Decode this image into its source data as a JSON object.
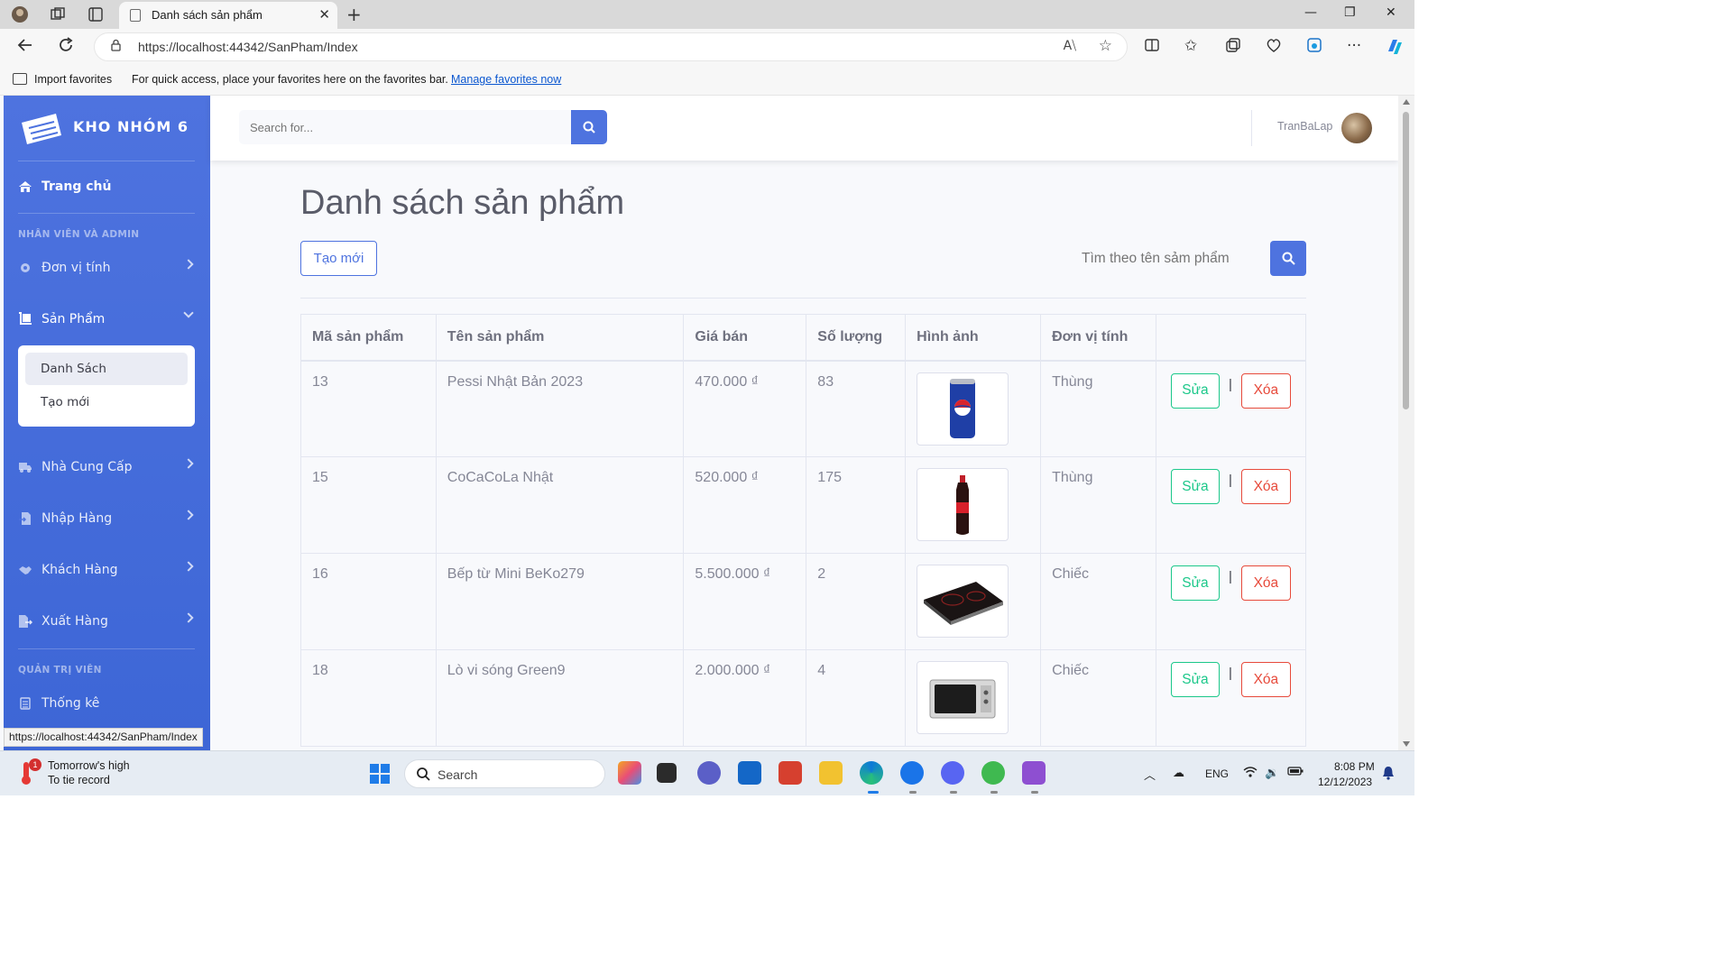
{
  "browser": {
    "tab_title": "Danh sách sản phẩm",
    "url": "https://localhost:44342/SanPham/Index",
    "favorites_import": "Import favorites",
    "favorites_message": "For quick access, place your favorites here on the favorites bar.",
    "favorites_link": "Manage favorites now",
    "status_url": "https://localhost:44342/SanPham/Index"
  },
  "sidebar": {
    "brand": "KHO NHÓM 6",
    "home": "Trang chủ",
    "heading_staff": "NHÂN VIÊN VÀ ADMIN",
    "heading_admin": "QUẢN TRỊ VIÊN",
    "items": [
      {
        "label": "Đơn vị tính",
        "icon": "gear-icon"
      },
      {
        "label": "Sản Phẩm",
        "icon": "dolly-icon"
      },
      {
        "label": "Nhà Cung Cấp",
        "icon": "truck-icon"
      },
      {
        "label": "Nhập Hàng",
        "icon": "file-import-icon"
      },
      {
        "label": "Khách Hàng",
        "icon": "handshake-icon"
      },
      {
        "label": "Xuất Hàng",
        "icon": "file-export-icon"
      }
    ],
    "submenu": [
      "Danh Sách",
      "Tạo mới"
    ],
    "stats": "Thống kê"
  },
  "topbar": {
    "search_placeholder": "Search for...",
    "username": "TranBaLap"
  },
  "main": {
    "title": "Danh sách sản phẩm",
    "create_button": "Tạo mới",
    "search_placeholder": "Tìm theo tên sảm phẩm",
    "columns": [
      "Mã sản phẩm",
      "Tên sản phẩm",
      "Giá bán",
      "Số lượng",
      "Hình ảnh",
      "Đơn vị tính",
      ""
    ],
    "edit_label": "Sửa",
    "separator": "|",
    "delete_label": "Xóa",
    "rows": [
      {
        "id": "13",
        "name": "Pessi Nhật Bản 2023",
        "price": "470.000 ₫",
        "qty": "83",
        "image": "pepsi-can",
        "unit": "Thùng"
      },
      {
        "id": "15",
        "name": "CoCaCoLa Nhật",
        "price": "520.000 ₫",
        "qty": "175",
        "image": "coca-bottle",
        "unit": "Thùng"
      },
      {
        "id": "16",
        "name": "Bếp từ Mini BeKo279",
        "price": "5.500.000 ₫",
        "qty": "2",
        "image": "induction-cooker",
        "unit": "Chiếc"
      },
      {
        "id": "18",
        "name": "Lò vi sóng Green9",
        "price": "2.000.000 ₫",
        "qty": "4",
        "image": "microwave",
        "unit": "Chiếc"
      }
    ]
  },
  "taskbar": {
    "weather_line1": "Tomorrow's high",
    "weather_line2": "To tie record",
    "weather_badge": "1",
    "search": "Search",
    "lang": "ENG",
    "time": "8:08 PM",
    "date": "12/12/2023"
  },
  "colors": {
    "primary": "#4e73df",
    "success": "#1cc88a",
    "danger": "#e74a3b"
  }
}
